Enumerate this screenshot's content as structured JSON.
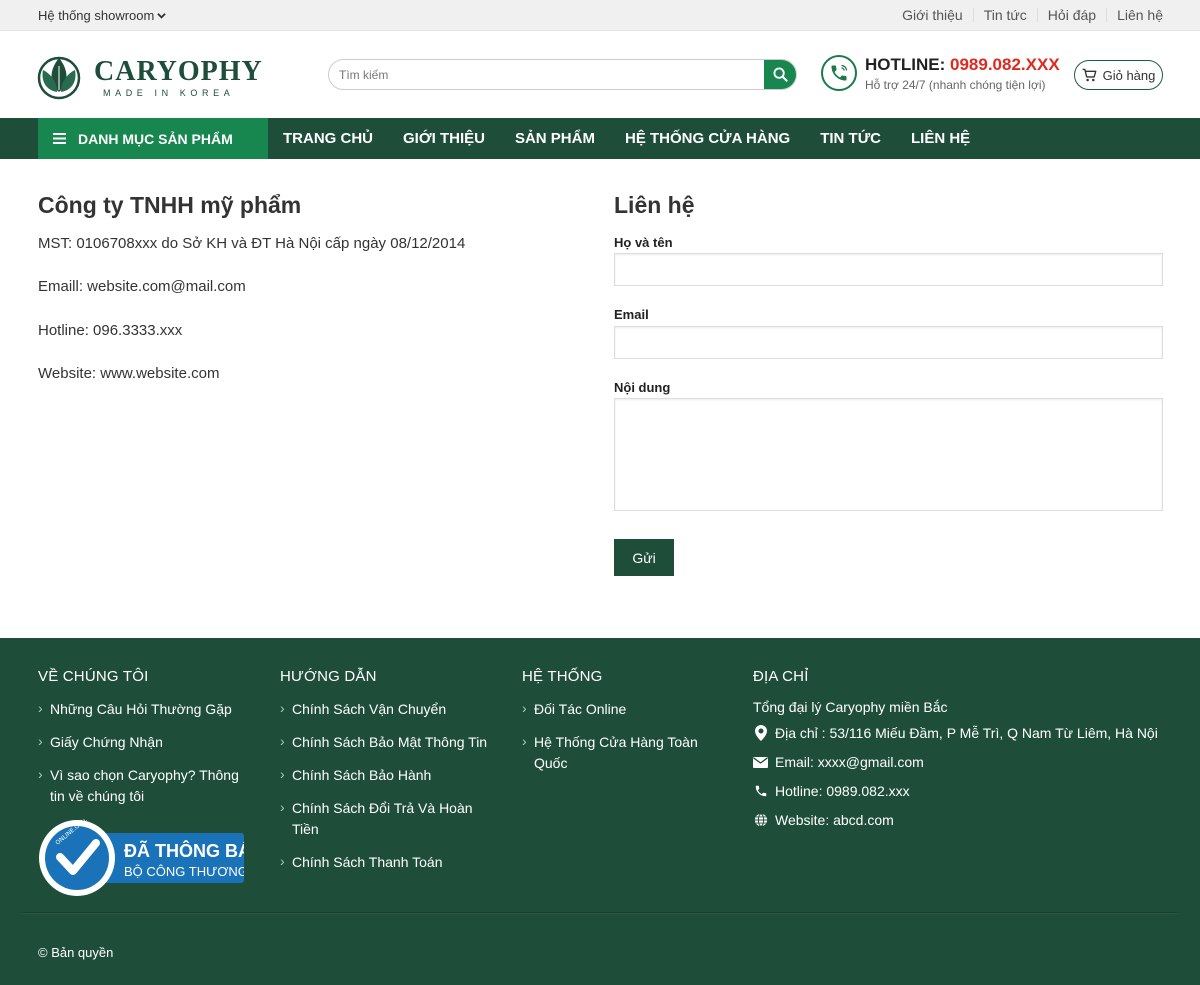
{
  "topbar": {
    "showroom_label": "Hệ thống showroom",
    "links": [
      "Giới thiệu",
      "Tin tức",
      "Hỏi đáp",
      "Liên hệ"
    ]
  },
  "header": {
    "logo_name": "CARYOPHY",
    "logo_sub": "MADE IN KOREA",
    "search_placeholder": "Tìm kiếm",
    "hotline_label": "HOTLINE:",
    "hotline_number": "0989.082.XXX",
    "hotline_sub": "Hỗ trợ 24/7 (nhanh chóng tiện lợi)",
    "cart_label": "Giỏ hàng"
  },
  "nav": {
    "category_label": "DANH MỤC SẢN PHẨM",
    "items": [
      "TRANG CHỦ",
      "GIỚI THIỆU",
      "SẢN PHẨM",
      "HỆ THỐNG CỬA HÀNG",
      "TIN TỨC",
      "LIÊN HỆ"
    ]
  },
  "company": {
    "title": "Công ty TNHH mỹ phẩm",
    "lines": [
      "MST: 0106708xxx do Sở KH và ĐT Hà Nội cấp ngày 08/12/2014",
      "Emaill: website.com@mail.com",
      "Hotline: 096.3333.xxx",
      "Website: www.website.com"
    ]
  },
  "contact": {
    "title": "Liên hệ",
    "name_label": "Họ và tên",
    "email_label": "Email",
    "content_label": "Nội dung",
    "submit_label": "Gửi"
  },
  "footer": {
    "about": {
      "heading": "VỀ CHÚNG TÔI",
      "items": [
        "Những Câu Hỏi Thường Gặp",
        "Giấy Chứng Nhận",
        "Vì sao chọn Caryophy? Thông tin về chúng tôi"
      ]
    },
    "guide": {
      "heading": "HƯỚNG DẪN",
      "items": [
        "Chính Sách Vận Chuyển",
        "Chính Sách Bảo Mật Thông Tin",
        "Chính Sách Bảo Hành",
        "Chính Sách Đổi Trả Và Hoàn Tiền",
        "Chính Sách Thanh Toán"
      ]
    },
    "system": {
      "heading": "HỆ THỐNG",
      "items": [
        "Đối Tác Online",
        "Hệ Thống Cửa Hàng Toàn Quốc"
      ]
    },
    "address": {
      "heading": "ĐỊA CHỈ",
      "title": "Tổng đại lý Caryophy miền Bắc",
      "address": "Địa chỉ : 53/116 Miếu Đầm, P Mễ Trì, Q Nam Từ Liêm, Hà Nội",
      "email": "Email: xxxx@gmail.com",
      "hotline": "Hotline: 0989.082.xxx",
      "website": "Website: abcd.com"
    },
    "badge": {
      "line1": "ĐÃ THÔNG BÁO",
      "line2": "BỘ CÔNG THƯƠNG",
      "ring_text": "ONLINE.GOV.VN"
    },
    "copyright": "© Bản quyền"
  },
  "colors": {
    "primary_dark": "#1e4d3a",
    "primary_green": "#17864f",
    "hotline_red": "#e02a1f"
  }
}
